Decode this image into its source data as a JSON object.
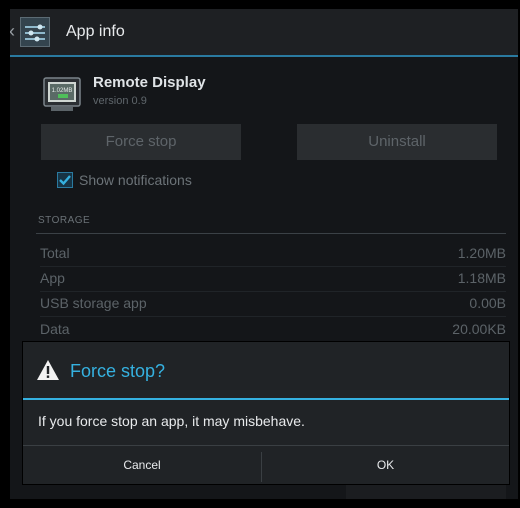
{
  "actionbar": {
    "title": "App info"
  },
  "app": {
    "name": "Remote Display",
    "version": "version 0.9",
    "icon_text": "1.02MB"
  },
  "buttons": {
    "force_stop": "Force stop",
    "uninstall": "Uninstall"
  },
  "notifications": {
    "label": "Show notifications",
    "checked": true
  },
  "storage": {
    "header": "STORAGE",
    "rows": [
      {
        "label": "Total",
        "value": "1.20MB"
      },
      {
        "label": "App",
        "value": "1.18MB"
      },
      {
        "label": "USB storage app",
        "value": "0.00B"
      },
      {
        "label": "Data",
        "value": "20.00KB"
      }
    ]
  },
  "dialog": {
    "title": "Force stop?",
    "message": "If you force stop an app, it may misbehave.",
    "cancel": "Cancel",
    "ok": "OK"
  },
  "colors": {
    "accent": "#35b1e0",
    "background": "#141619",
    "dialog": "#202326"
  }
}
